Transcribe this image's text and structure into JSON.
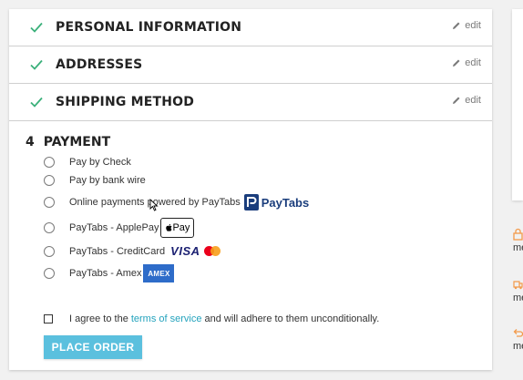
{
  "steps": [
    {
      "title": "PERSONAL INFORMATION",
      "edit": "edit"
    },
    {
      "title": "ADDRESSES",
      "edit": "edit"
    },
    {
      "title": "SHIPPING METHOD",
      "edit": "edit"
    }
  ],
  "payment": {
    "number": "4",
    "title": "PAYMENT",
    "options": [
      {
        "label": "Pay by Check"
      },
      {
        "label": "Pay by bank wire"
      },
      {
        "label": "Online payments powered by PayTabs",
        "logo": "PayTabs"
      },
      {
        "label": "PayTabs - ApplePay",
        "logo": "Pay"
      },
      {
        "label": "PayTabs - CreditCard",
        "logo": "VISA"
      },
      {
        "label": "PayTabs - Amex",
        "logo": "AMEX"
      }
    ],
    "terms_before": "I agree to the",
    "terms_link": "terms of service",
    "terms_after": "and will adhere to them unconditionally.",
    "place_order": "PLACE ORDER"
  },
  "right_panel": {
    "items": [
      {
        "text": "me",
        "icon": "lock-icon"
      },
      {
        "text": "me",
        "icon": "truck-icon"
      },
      {
        "text": "me",
        "icon": "return-icon"
      }
    ]
  },
  "colors": {
    "check": "#3ab07a",
    "accent": "#5bc0de",
    "link": "#24a3bd",
    "icon_orange": "#f39a4a"
  }
}
